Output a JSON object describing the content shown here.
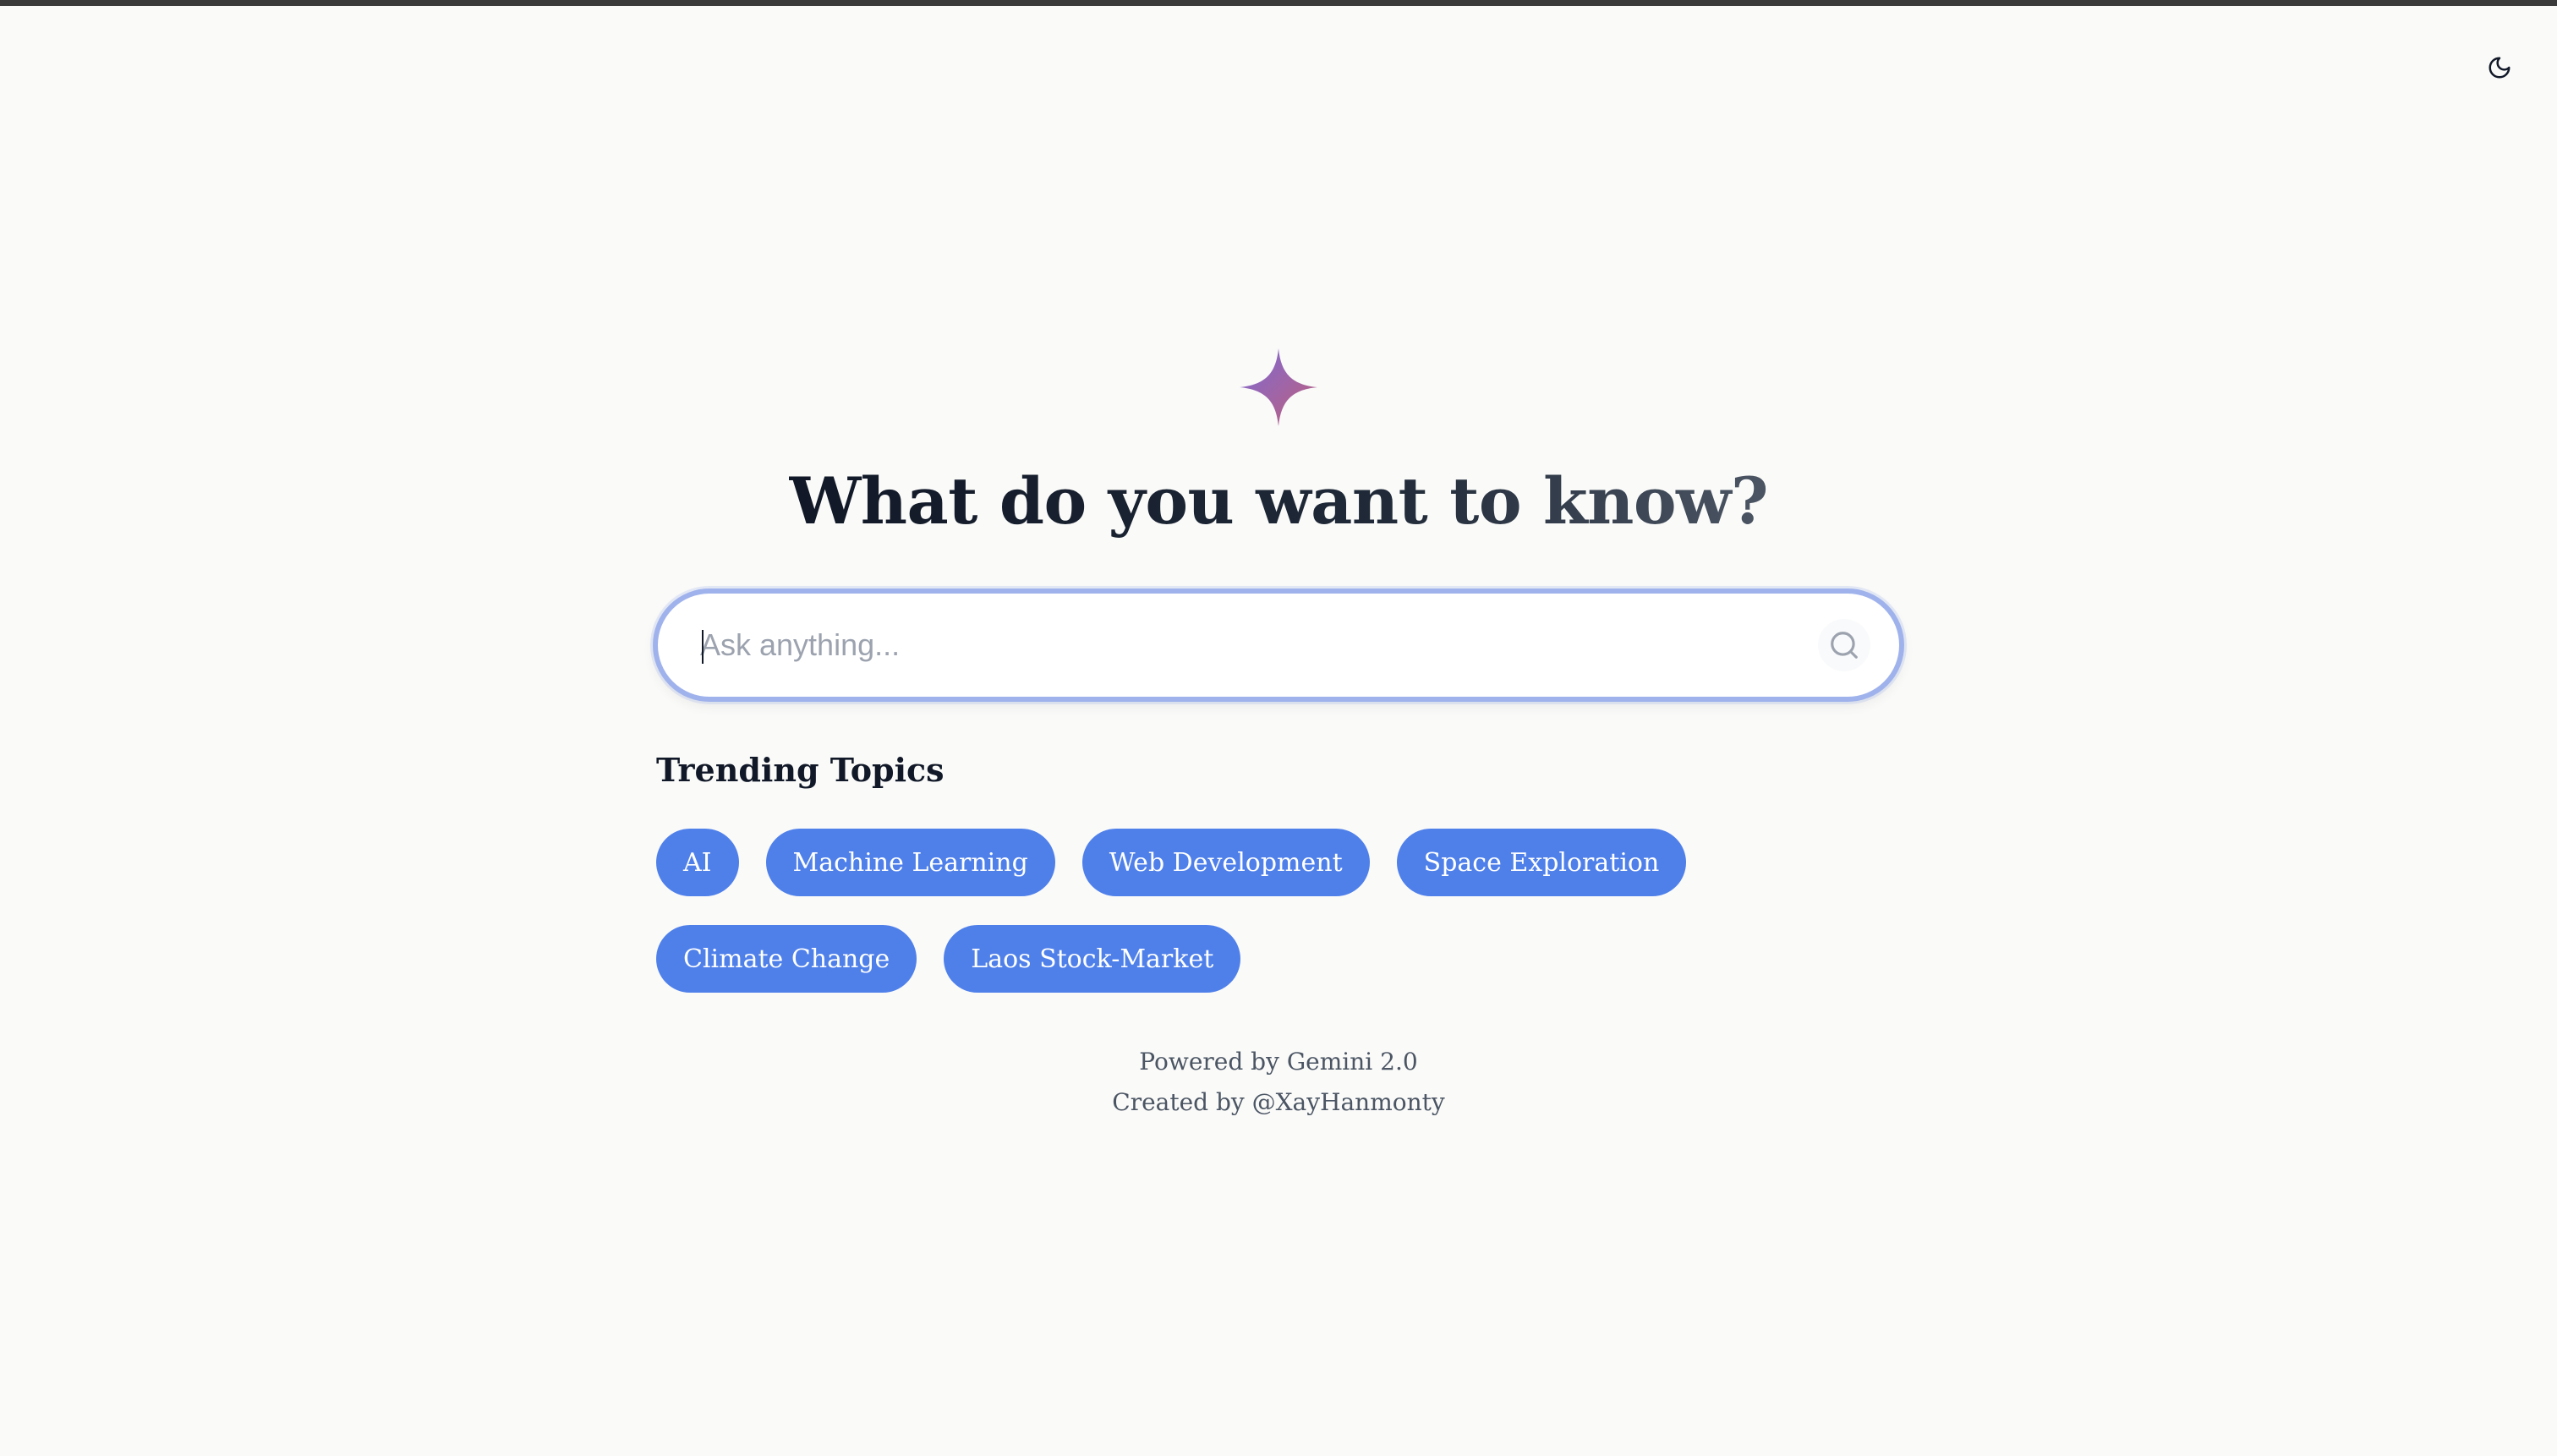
{
  "theme_toggle": {
    "icon": "moon-icon"
  },
  "logo": {
    "icon": "sparkle-icon",
    "colors": [
      "#7c6ad6",
      "#c0607a"
    ]
  },
  "hero": {
    "heading": "What do you want to know?"
  },
  "search": {
    "placeholder": "Ask anything...",
    "value": "",
    "button_icon": "search-icon"
  },
  "trending": {
    "title": "Trending Topics",
    "topics": [
      "AI",
      "Machine Learning",
      "Web Development",
      "Space Exploration",
      "Climate Change",
      "Laos Stock-Market"
    ]
  },
  "footer": {
    "powered_by": "Powered by Gemini 2.0",
    "created_by": "Created by @XayHanmonty"
  },
  "colors": {
    "background": "#fafaf9",
    "accent": "#4f80ea",
    "search_border": "#9fb2ec",
    "heading": "#1f2937",
    "muted_text": "#4b5563"
  }
}
